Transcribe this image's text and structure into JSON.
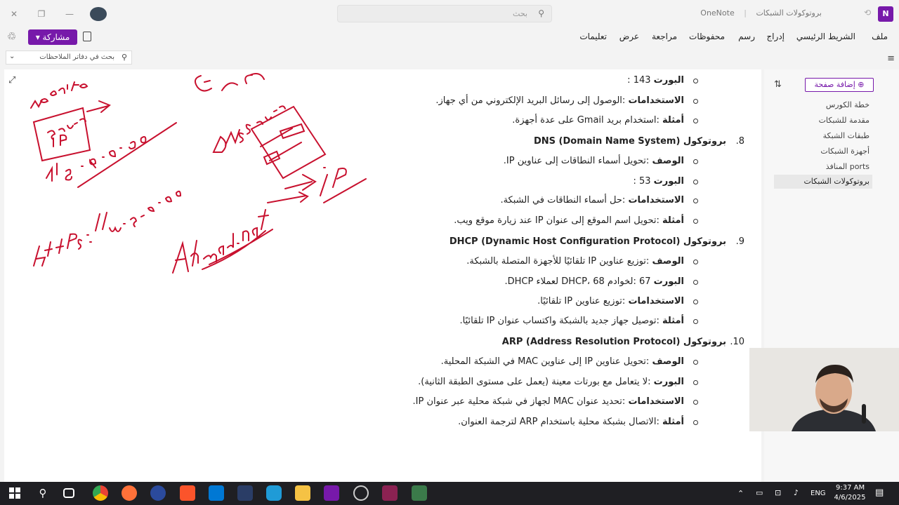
{
  "window": {
    "app_name": "OneNote",
    "notebook_title": "بروتوكولات الشبكات",
    "search_placeholder": "بحث"
  },
  "menu": {
    "items": [
      "ملف",
      "الشريط الرئيسي",
      "إدراج",
      "رسم",
      "محفوظات",
      "مراجعة",
      "عرض",
      "تعليمات"
    ],
    "share_label": "مشاركة"
  },
  "notebook_search_placeholder": "بحث في دفاتر الملاحظات",
  "pages": {
    "add_page_label": "إضافة صفحة",
    "items": [
      "خطة الكورس",
      "مقدمة للشبكات",
      "طبقات الشبكة",
      "أجهزة الشبكات",
      "ports المنافذ",
      "بروتوكولات الشبكات"
    ],
    "active_index": 5
  },
  "content": {
    "lines": [
      {
        "type": "bullet",
        "label": "البورت",
        "text": "143 :"
      },
      {
        "type": "bullet",
        "label": "الاستخدامات",
        "text": ":الوصول إلى رسائل البريد الإلكتروني من أي جهاز."
      },
      {
        "type": "bullet",
        "label": "أمثلة",
        "text": ":استخدام بريد Gmail على عدة أجهزة."
      },
      {
        "type": "heading",
        "num": "8.",
        "text": "بروتوكول DNS (Domain Name System)"
      },
      {
        "type": "bullet",
        "label": "الوصف",
        "text": ":تحويل أسماء النطاقات إلى عناوين IP."
      },
      {
        "type": "bullet",
        "label": "البورت",
        "text": "53 :"
      },
      {
        "type": "bullet",
        "label": "الاستخدامات",
        "text": ":حل أسماء النطاقات في الشبكة."
      },
      {
        "type": "bullet",
        "label": "أمثلة",
        "text": ":تحويل اسم الموقع إلى عنوان IP عند زيارة موقع ويب."
      },
      {
        "type": "heading",
        "num": "9.",
        "text": "بروتوكول DHCP (Dynamic Host Configuration Protocol)"
      },
      {
        "type": "bullet",
        "label": "الوصف",
        "text": ":توزيع عناوين IP تلقائيًا للأجهزة المتصلة بالشبكة."
      },
      {
        "type": "bullet",
        "label": "البورت",
        "text": "67 :لخوادم DHCP، 68 لعملاء DHCP."
      },
      {
        "type": "bullet",
        "label": "الاستخدامات",
        "text": ":توزيع عناوين IP تلقائيًا."
      },
      {
        "type": "bullet",
        "label": "أمثلة",
        "text": ":توصيل جهاز جديد بالشبكة واكتساب عنوان IP تلقائيًا."
      },
      {
        "type": "heading",
        "num": "10.",
        "text": "بروتوكول ARP (Address Resolution Protocol)"
      },
      {
        "type": "bullet",
        "label": "الوصف",
        "text": ":تحويل عناوين IP إلى عناوين MAC في الشبكة المحلية."
      },
      {
        "type": "bullet",
        "label": "البورت",
        "text": ":لا يتعامل مع بورتات معينة (يعمل على مستوى الطبقة الثانية)."
      },
      {
        "type": "bullet",
        "label": "الاستخدامات",
        "text": ":تحديد عنوان MAC لجهاز في شبكة محلية عبر عنوان IP."
      },
      {
        "type": "bullet",
        "label": "أمثلة",
        "text": ":الاتصال بشبكة محلية باستخدام ARP لترجمة العنوان."
      }
    ]
  },
  "taskbar": {
    "language": "ENG",
    "time": "9:37 AM",
    "date": "4/6/2025"
  },
  "colors": {
    "accent": "#7719aa",
    "ink": "#c8102e"
  }
}
